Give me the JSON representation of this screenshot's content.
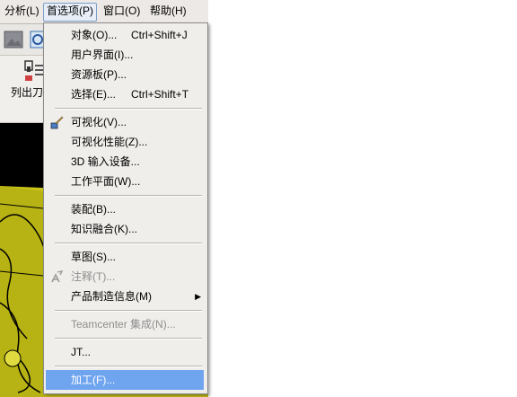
{
  "menubar": {
    "items": [
      {
        "label": "分析(L)"
      },
      {
        "label": "首选项(P)"
      },
      {
        "label": "窗口(O)"
      },
      {
        "label": "帮助(H)"
      }
    ]
  },
  "ribbon": {
    "label": "列出刀"
  },
  "menu": {
    "items": [
      {
        "label": "对象(O)...",
        "shortcut": "Ctrl+Shift+J"
      },
      {
        "label": "用户界面(I)..."
      },
      {
        "label": "资源板(P)..."
      },
      {
        "label": "选择(E)...",
        "shortcut": "Ctrl+Shift+T"
      },
      {
        "label": "可视化(V)...",
        "icon": "visualization-icon"
      },
      {
        "label": "可视化性能(Z)..."
      },
      {
        "label": "3D 输入设备..."
      },
      {
        "label": "工作平面(W)..."
      },
      {
        "label": "装配(B)..."
      },
      {
        "label": "知识融合(K)..."
      },
      {
        "label": "草图(S)..."
      },
      {
        "label": "注释(T)...",
        "icon": "annotation-icon",
        "disabled": true
      },
      {
        "label": "产品制造信息(M)",
        "submenu": true
      },
      {
        "label": "Teamcenter 集成(N)...",
        "disabled": true
      },
      {
        "label": "JT..."
      },
      {
        "label": "加工(F)...",
        "highlighted": true
      }
    ]
  },
  "colors": {
    "highlight": "#6fa5ef",
    "viewport_background": "#000000",
    "model_fill": "#c8c41a"
  }
}
